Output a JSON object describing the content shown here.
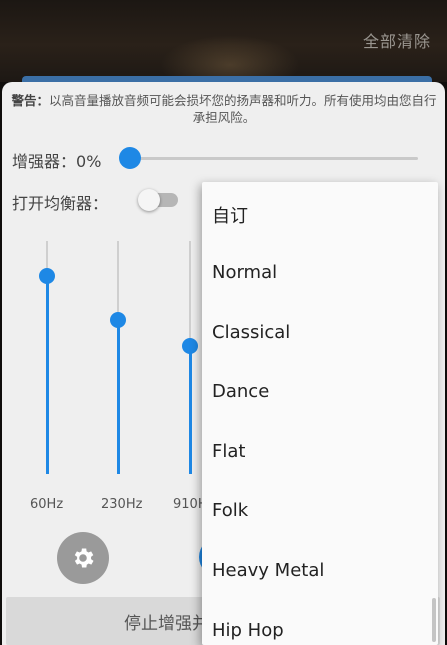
{
  "topbar": {
    "clear_all": "全部清除"
  },
  "warning": {
    "prefix": "警告：",
    "text": "以高音量播放音频可能会损坏您的扬声器和听力。所有使用均由您自行承担风险。"
  },
  "booster": {
    "label": "增强器：",
    "value_text": "0%",
    "level_percent": 0
  },
  "equalizer": {
    "toggle_label": "打开均衡器：",
    "enabled": false,
    "bands": [
      {
        "label": "60Hz",
        "level_percent": 85
      },
      {
        "label": "230Hz",
        "level_percent": 66
      },
      {
        "label": "910H",
        "level_percent": 55
      }
    ]
  },
  "actions": {
    "stop_label": "停止增强并"
  },
  "presets_menu": {
    "items": [
      "自订",
      "Normal",
      "Classical",
      "Dance",
      "Flat",
      "Folk",
      "Heavy Metal",
      "Hip Hop"
    ]
  },
  "colors": {
    "accent": "#1e88e5",
    "panel": "#efefef",
    "menu": "#fafafa"
  },
  "icons": {
    "settings": "gear-icon"
  }
}
